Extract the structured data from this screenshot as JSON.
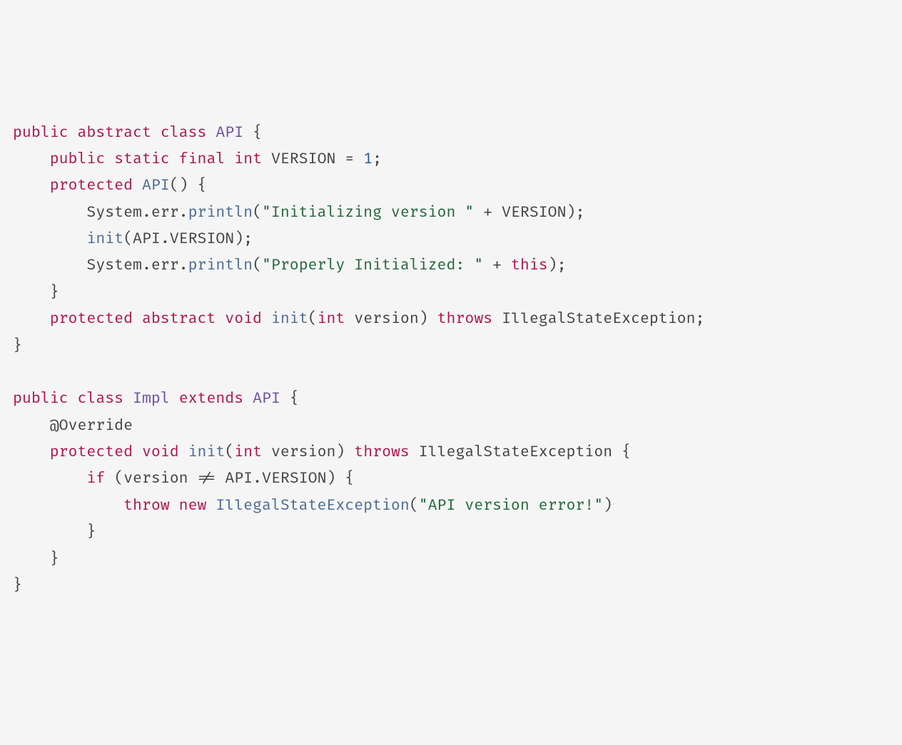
{
  "code": {
    "line1": {
      "t1": "public",
      "t2": "abstract",
      "t3": "class",
      "t4": "API",
      "t5": "{"
    },
    "line2": {
      "t1": "public",
      "t2": "static",
      "t3": "final",
      "t4": "int",
      "t5": "VERSION",
      "t6": "=",
      "t7": "1",
      "t8": ";"
    },
    "line3": {
      "t1": "protected",
      "t2": "API",
      "t3": "()",
      "t4": "{"
    },
    "line4": {
      "t1": "System",
      "t2": ".",
      "t3": "err",
      "t4": ".",
      "t5": "println",
      "t6": "(",
      "t7": "\"Initializing version \"",
      "t8": "+",
      "t9": "VERSION",
      "t10": ");"
    },
    "line5": {
      "t1": "init",
      "t2": "(",
      "t3": "API",
      "t4": ".",
      "t5": "VERSION",
      "t6": ");"
    },
    "line6": {
      "t1": "System",
      "t2": ".",
      "t3": "err",
      "t4": ".",
      "t5": "println",
      "t6": "(",
      "t7": "\"Properly Initialized: \"",
      "t8": "+",
      "t9": "this",
      "t10": ");"
    },
    "line7": {
      "t1": "}"
    },
    "line8": {
      "t1": "protected",
      "t2": "abstract",
      "t3": "void",
      "t4": "init",
      "t5": "(",
      "t6": "int",
      "t7": "version",
      "t8": ")",
      "t9": "throws",
      "t10": "IllegalStateException",
      "t11": ";"
    },
    "line9": {
      "t1": "}"
    },
    "line10": {
      "t1": ""
    },
    "line11": {
      "t1": "public",
      "t2": "class",
      "t3": "Impl",
      "t4": "extends",
      "t5": "API",
      "t6": "{"
    },
    "line12": {
      "t1": "@Override"
    },
    "line13": {
      "t1": "protected",
      "t2": "void",
      "t3": "init",
      "t4": "(",
      "t5": "int",
      "t6": "version",
      "t7": ")",
      "t8": "throws",
      "t9": "IllegalStateException",
      "t10": "{"
    },
    "line14": {
      "t1": "if",
      "t2": "(",
      "t3": "version",
      "t4": "!=",
      "t5": "API",
      "t6": ".",
      "t7": "VERSION",
      "t8": ")",
      "t9": "{"
    },
    "line15": {
      "t1": "throw",
      "t2": "new",
      "t3": "IllegalStateException",
      "t4": "(",
      "t5": "\"API version error!\"",
      "t6": ")"
    },
    "line16": {
      "t1": "}"
    },
    "line17": {
      "t1": "}"
    },
    "line18": {
      "t1": "}"
    }
  }
}
